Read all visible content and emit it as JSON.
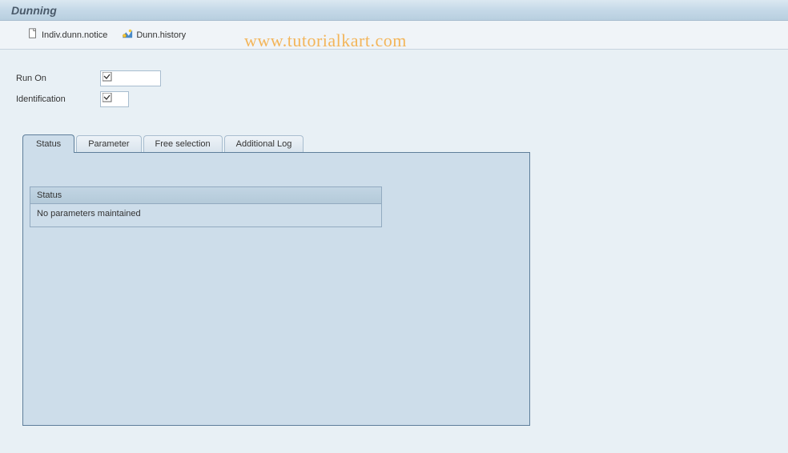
{
  "header": {
    "title": "Dunning"
  },
  "toolbar": {
    "indiv_dunn_notice": "Indiv.dunn.notice",
    "dunn_history": "Dunn.history"
  },
  "watermark": "www.tutorialkart.com",
  "form": {
    "run_on_label": "Run On",
    "run_on_value": "",
    "identification_label": "Identification",
    "identification_value": ""
  },
  "tabs": {
    "status": "Status",
    "parameter": "Parameter",
    "free_selection": "Free selection",
    "additional_log": "Additional Log",
    "active": "status"
  },
  "panel": {
    "status_group_title": "Status",
    "status_message": "No parameters maintained"
  }
}
